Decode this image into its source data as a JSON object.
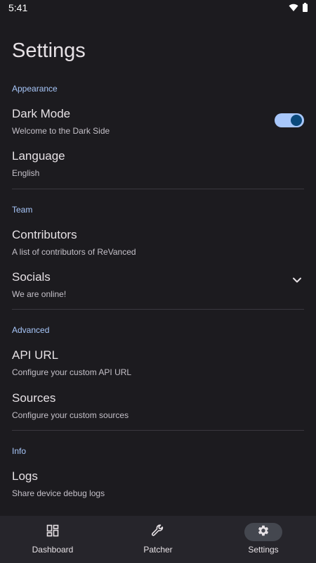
{
  "status_bar": {
    "time": "5:41"
  },
  "page": {
    "title": "Settings"
  },
  "sections": {
    "appearance": {
      "header": "Appearance"
    },
    "team": {
      "header": "Team"
    },
    "advanced": {
      "header": "Advanced"
    },
    "info": {
      "header": "Info"
    }
  },
  "items": {
    "dark_mode": {
      "title": "Dark Mode",
      "subtitle": "Welcome to the Dark Side",
      "enabled": true
    },
    "language": {
      "title": "Language",
      "subtitle": "English"
    },
    "contributors": {
      "title": "Contributors",
      "subtitle": "A list of contributors of ReVanced"
    },
    "socials": {
      "title": "Socials",
      "subtitle": "We are online!"
    },
    "api_url": {
      "title": "API URL",
      "subtitle": "Configure your custom API URL"
    },
    "sources": {
      "title": "Sources",
      "subtitle": "Configure your custom sources"
    },
    "logs": {
      "title": "Logs",
      "subtitle": "Share device debug logs"
    }
  },
  "bottom_nav": {
    "items": [
      {
        "label": "Dashboard",
        "icon": "dashboard-icon",
        "active": false
      },
      {
        "label": "Patcher",
        "icon": "wrench-icon",
        "active": false
      },
      {
        "label": "Settings",
        "icon": "gear-icon",
        "active": true
      }
    ]
  },
  "colors": {
    "background": "#1c1b1f",
    "accent": "#a8c7fa",
    "nav_background": "#26252b"
  }
}
